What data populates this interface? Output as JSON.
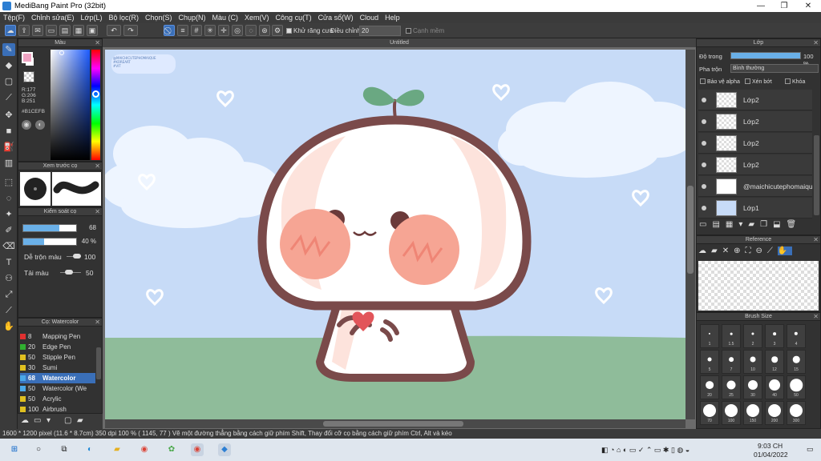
{
  "window": {
    "title": "MediBang Paint Pro (32bit)",
    "minimize": "—",
    "maximize": "❐",
    "close": "✕"
  },
  "menu": [
    "Tệp(F)",
    "Chỉnh sửa(E)",
    "Lớp(L)",
    "Bộ lọc(R)",
    "Chọn(S)",
    "Chụp(N)",
    "Màu (C)",
    "Xem(V)",
    "Công cụ(T)",
    "Cửa sổ(W)",
    "Cloud",
    "Help"
  ],
  "toolbar": {
    "antialias_label": "Khử răng cưa",
    "correction_label": "Điều chỉnh",
    "correction_value": "20",
    "edge_label": "Cạnh mềm"
  },
  "color_panel": {
    "title": "Màu",
    "r": "R:177",
    "g": "G:206",
    "b": "B:251",
    "hex": "#B1CEFB",
    "fg_color": "#f0a3c2"
  },
  "preview_panel": {
    "title": "Xem trước cọ"
  },
  "brush_control": {
    "title": "Kiểm soát cọ",
    "size_value": "68",
    "opacity_value": "40 %",
    "mix_label": "Dễ trộn màu",
    "mix_value": "100",
    "load_label": "Tải màu",
    "load_value": "50"
  },
  "brush_list": {
    "title": "Cọ: Watercolor",
    "items": [
      {
        "size": "8",
        "name": "Mapping Pen",
        "color": "#e03030"
      },
      {
        "size": "20",
        "name": "Edge Pen",
        "color": "#30b030"
      },
      {
        "size": "50",
        "name": "Stipple Pen",
        "color": "#e0c020"
      },
      {
        "size": "30",
        "name": "Sumi",
        "color": "#e0c020"
      },
      {
        "size": "68",
        "name": "Watercolor",
        "color": "#4aa8e8"
      },
      {
        "size": "50",
        "name": "Watercolor (We",
        "color": "#4aa8e8"
      },
      {
        "size": "50",
        "name": "Acrylic",
        "color": "#e0c020"
      },
      {
        "size": "100",
        "name": "Airbrush",
        "color": "#e0c020"
      }
    ]
  },
  "canvas": {
    "tab_title": "Untitled",
    "watermark": "@MAICHICUTEPHOMAIQUE\n#KOREART\n#VIT"
  },
  "layer_panel": {
    "title": "Lớp",
    "opacity_label": "Độ trong",
    "opacity_value": "100 %",
    "blend_label": "Pha trộn",
    "blend_value": "Bình thường",
    "protect_alpha": "Bảo vệ alpha",
    "clip": "Xén bớt",
    "lock": "Khóa",
    "layers": [
      "Lớp2",
      "Lớp2",
      "Lớp2",
      "Lớp2",
      "@maichicutephomaiqu",
      "Lớp1"
    ]
  },
  "reference_panel": {
    "title": "Reference"
  },
  "brush_size_panel": {
    "title": "Brush Size",
    "sizes": [
      "1",
      "1.5",
      "2",
      "3",
      "4",
      "5",
      "7",
      "10",
      "12",
      "15",
      "20",
      "25",
      "30",
      "40",
      "50",
      "70",
      "100",
      "150",
      "200",
      "300"
    ]
  },
  "status": {
    "text": "1600 * 1200 pixel   (11.6 * 8.7cm)   350 dpi   100 %   ( 1145, 77 )   Vẽ một đường thẳng bằng cách giữ phím Shift, Thay đổi cỡ cọ bằng cách giữ phím Ctrl, Alt và kéo"
  },
  "taskbar": {
    "time": "9:03 CH",
    "date": "01/04/2022"
  }
}
